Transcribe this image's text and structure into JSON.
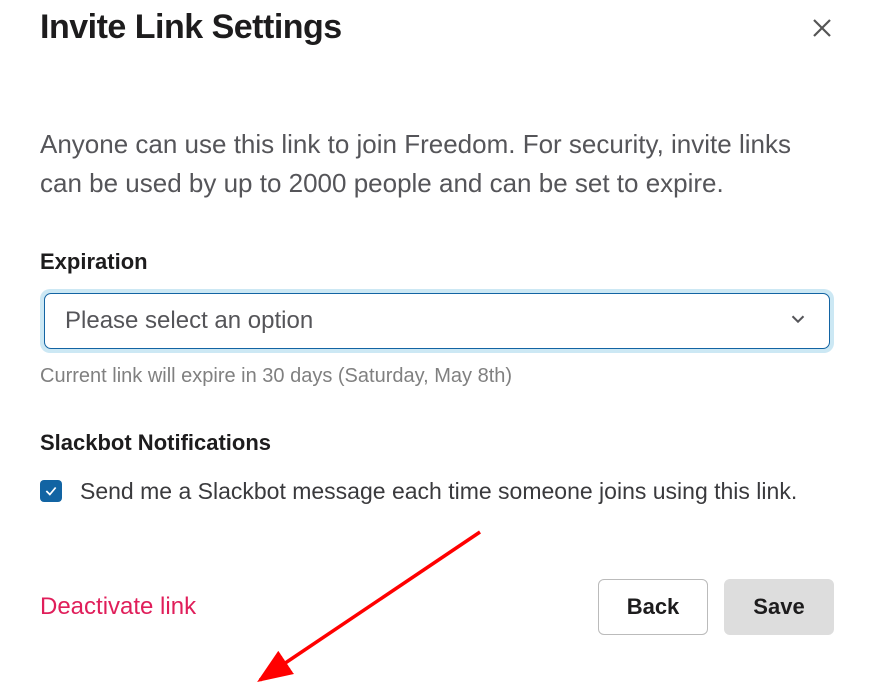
{
  "title": "Invite Link Settings",
  "description": "Anyone can use this link to join Freedom. For security, invite links can be used by up to 2000 people and can be set to expire.",
  "expiration": {
    "label": "Expiration",
    "placeholder": "Please select an option",
    "hint": "Current link will expire in 30 days (Saturday, May 8th)"
  },
  "notifications": {
    "label": "Slackbot Notifications",
    "checkbox_checked": true,
    "checkbox_text": "Send me a Slackbot message each time someone joins using this link."
  },
  "footer": {
    "deactivate": "Deactivate link",
    "back": "Back",
    "save": "Save"
  }
}
